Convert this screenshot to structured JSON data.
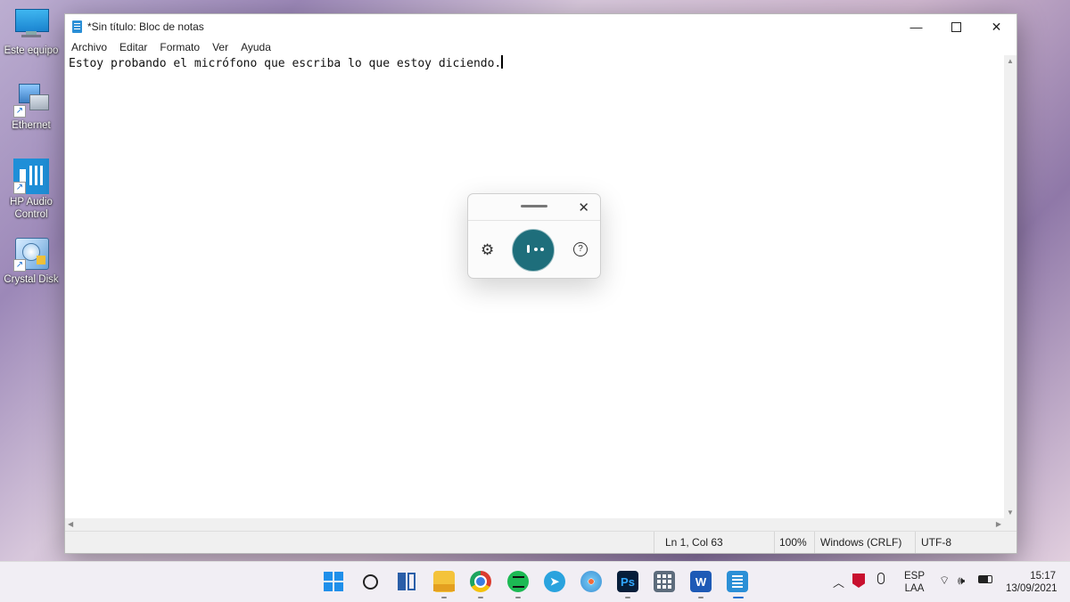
{
  "desktop": {
    "icons": [
      {
        "label": "Este equipo",
        "icon": "monitor-icon"
      },
      {
        "label": "Ethernet",
        "icon": "network-icon"
      },
      {
        "label": "HP Audio Control",
        "icon": "audio-control-icon"
      },
      {
        "label": "Crystal Disk",
        "icon": "crystal-disk-icon"
      }
    ]
  },
  "window": {
    "title": "*Sin título: Bloc de notas",
    "menu": [
      "Archivo",
      "Editar",
      "Formato",
      "Ver",
      "Ayuda"
    ],
    "content": "Estoy probando el micrófono que escriba lo que estoy diciendo.",
    "status": {
      "position": "Ln 1, Col 63",
      "zoom": "100%",
      "line_ending": "Windows (CRLF)",
      "encoding": "UTF-8"
    }
  },
  "voice_typing": {
    "close_glyph": "✕",
    "state": "listening"
  },
  "taskbar": {
    "apps": [
      "start-icon",
      "search-icon",
      "task-view-icon",
      "file-explorer-icon",
      "chrome-icon",
      "spotify-icon",
      "telegram-icon",
      "paint-icon",
      "photoshop-icon",
      "calculator-icon",
      "word-icon",
      "notepad-icon"
    ],
    "photoshop_label": "Ps",
    "word_label": "W",
    "tray": {
      "language_top": "ESP",
      "language_bottom": "LAA",
      "time": "15:17",
      "date": "13/09/2021"
    }
  },
  "colors": {
    "mic_button": "#1e6e7b",
    "notepad_accent": "#2b8fd6"
  }
}
